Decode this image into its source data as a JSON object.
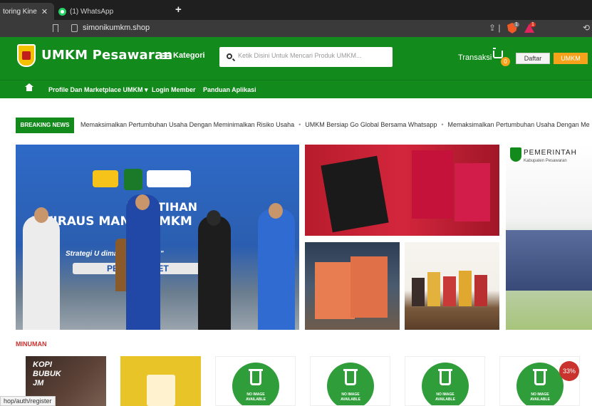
{
  "browser": {
    "active_tab": "toring Kine",
    "inactive_tab": "(1) WhatsApp",
    "url": "simonikumkm.shop",
    "brave_count": "1",
    "rewards_count": "1"
  },
  "header": {
    "brand": "UMKM Pesawaran",
    "kategori": "Kategori",
    "search_placeholder": "Ketik Disini Untuk Mencari Produk UMKM...",
    "transaksi": "Transaksi",
    "cart_count": "0",
    "daftar": "Daftar",
    "umkm": "UMKM"
  },
  "nav": {
    "items": [
      "Profile Dan Marketplace UMKM ▾",
      "Login Member",
      "Panduan Aplikasi"
    ]
  },
  "news": {
    "label": "BREAKING NEWS",
    "items": [
      "Memaksimalkan Pertumbuhan Usaha Dengan Meminimalkan Risiko Usaha",
      "UMKM Bersiap Go Global Bersama Whatsapp",
      "Memaksimalkan Pertumbuhan Usaha Dengan Me"
    ]
  },
  "banner": {
    "title1": "PELATIHAN",
    "title2": "EWIRAUS        MANDI UMKM",
    "sub": "Strategi U        dimasa Pan       ID-19\"",
    "bar": "PES      17 MARET",
    "pemerintah": "PEMERINTAH",
    "pemerintah_sub": "Kabupaten Pesawaran"
  },
  "section": {
    "title": "MINUMAN"
  },
  "products": {
    "kopi_text": "KOPI\nBUBUK\nJM",
    "noimage": "NO IMAGE\nAVAILABLE",
    "discount": "33%"
  },
  "status_url": "hop/auth/register",
  "colors": {
    "brand_green": "#138a1c",
    "accent_orange": "#f6a21a",
    "section_red": "#c9322d"
  }
}
